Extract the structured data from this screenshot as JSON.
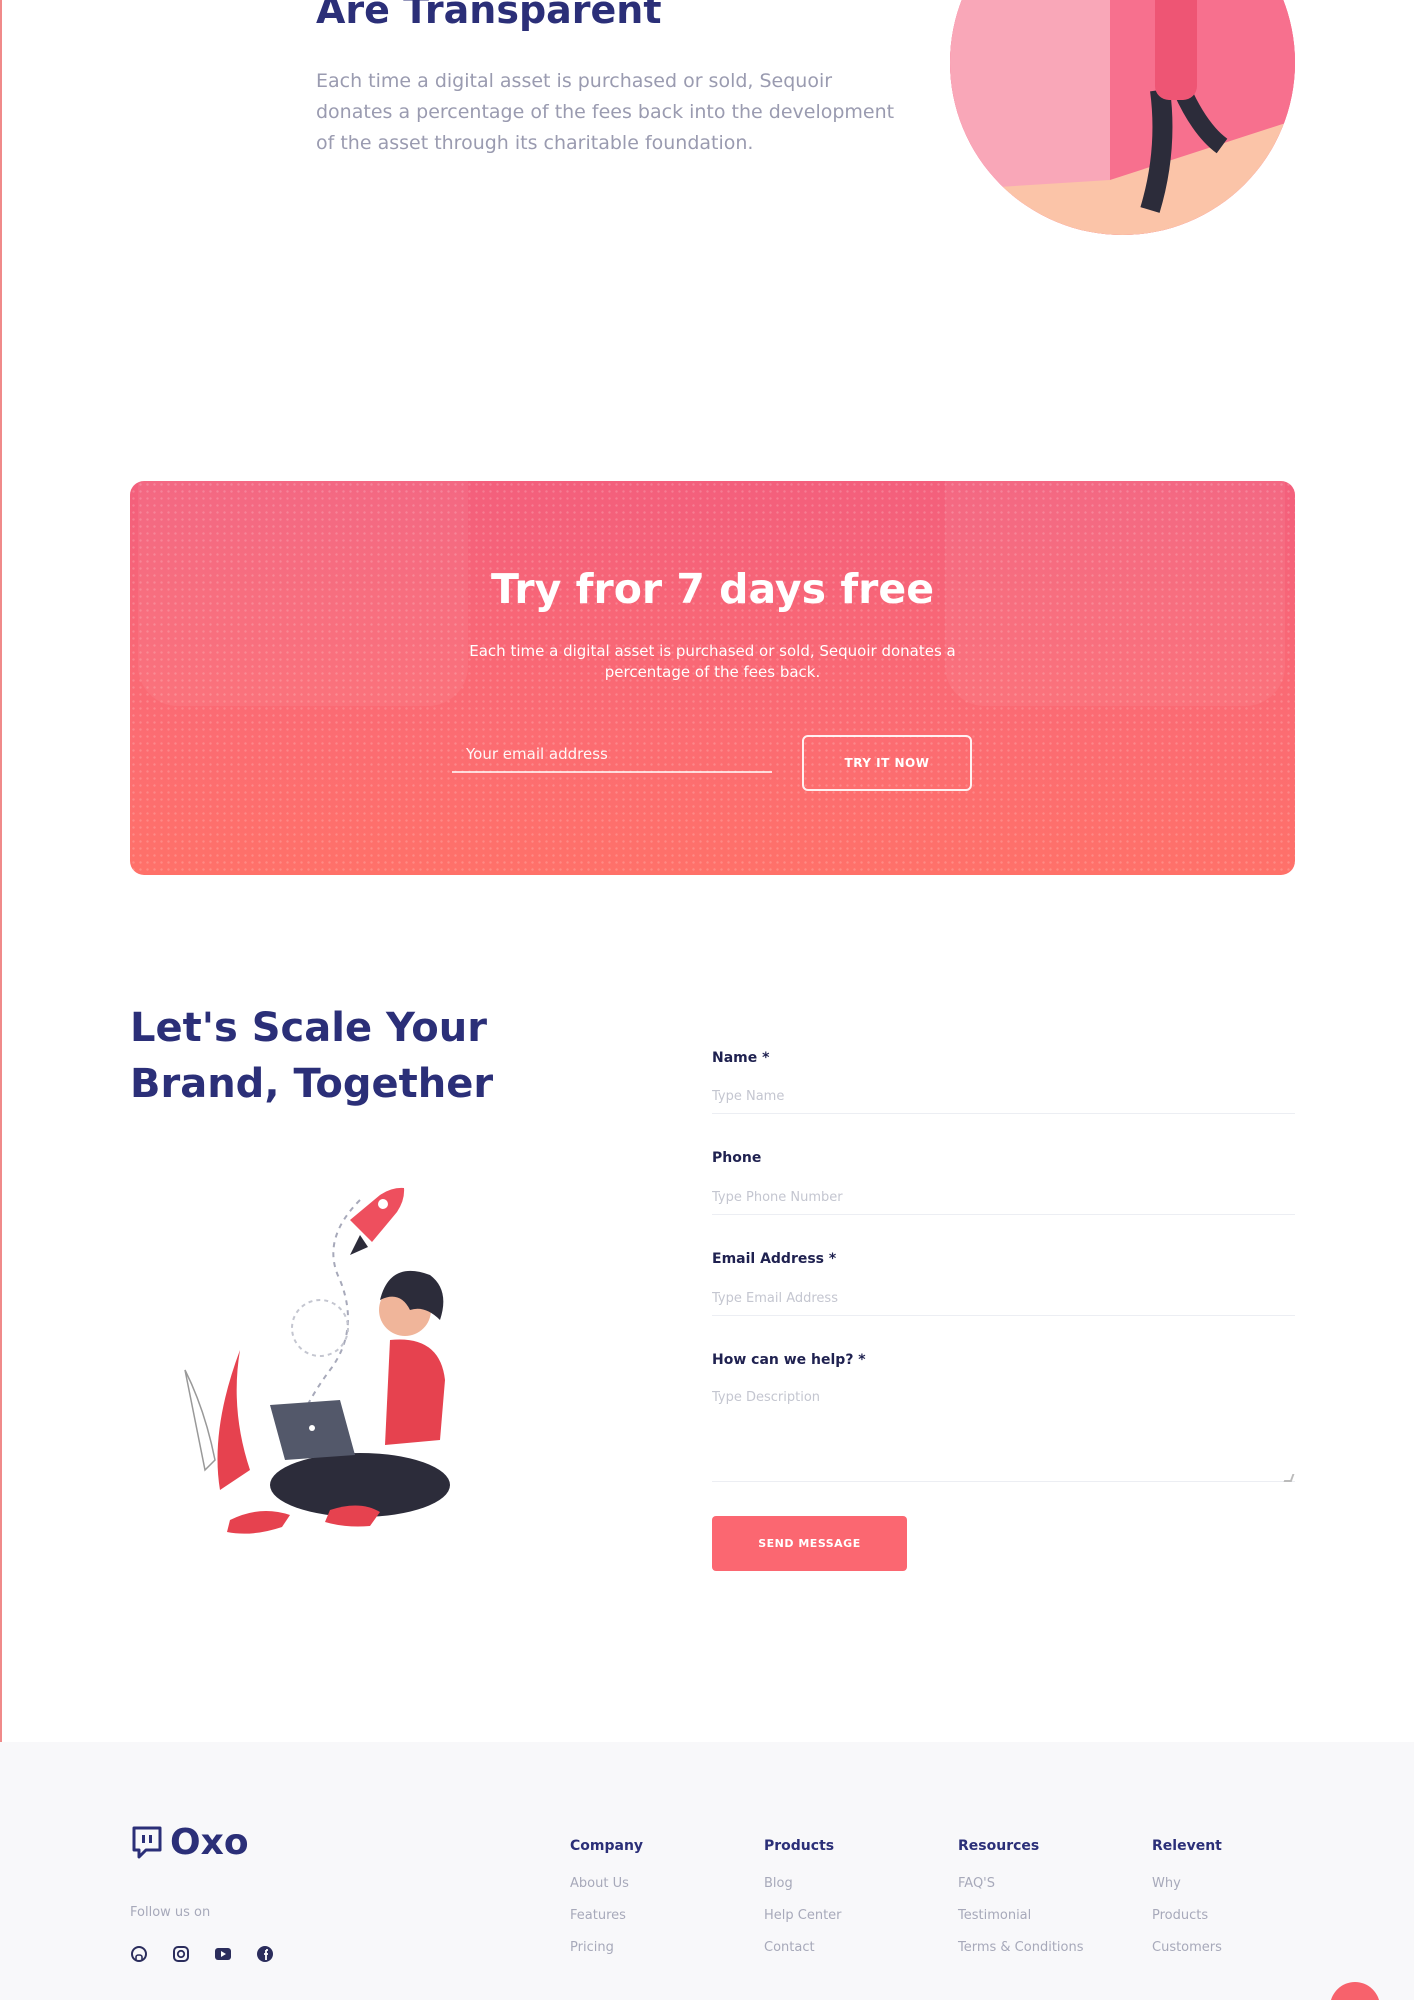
{
  "transparent": {
    "title": "Are Transparent",
    "description": "Each time a digital asset is purchased or sold, Sequoir donates a percentage of the fees back into the development of the asset through its charitable foundation."
  },
  "cta": {
    "title": "Try fror 7 days free",
    "description": "Each time a digital asset is purchased or sold, Sequoir donates a percentage of the fees back.",
    "email_placeholder": "Your email address",
    "button_label": "TRY IT NOW"
  },
  "contact": {
    "title": "Let's Scale Your Brand, Together",
    "fields": {
      "name_label": "Name *",
      "name_placeholder": "Type Name",
      "phone_label": "Phone",
      "phone_placeholder": "Type Phone Number",
      "email_label": "Email Address *",
      "email_placeholder": "Type Email Address",
      "help_label": "How can we help? *",
      "help_placeholder": "Type Description"
    },
    "send_label": "SEND MESSAGE"
  },
  "footer": {
    "logo": "Oxo",
    "follow": "Follow us on",
    "socials": [
      "github-icon",
      "instagram-icon",
      "youtube-icon",
      "facebook-icon"
    ],
    "columns": [
      {
        "title": "Company",
        "links": [
          "About Us",
          "Features",
          "Pricing"
        ]
      },
      {
        "title": "Products",
        "links": [
          "Blog",
          "Help Center",
          "Contact"
        ]
      },
      {
        "title": "Resources",
        "links": [
          "FAQ'S",
          "Testimonial",
          "Terms & Conditions"
        ]
      },
      {
        "title": "Relevent",
        "links": [
          "Why",
          "Products",
          "Customers"
        ]
      }
    ]
  },
  "colors": {
    "accent": "#fb6771",
    "heading": "#2b2f78",
    "muted": "#a7a9ba"
  }
}
